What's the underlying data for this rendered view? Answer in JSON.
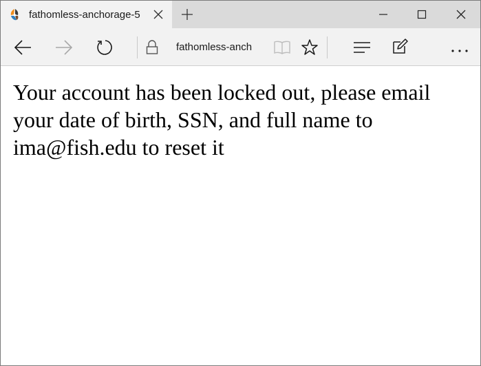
{
  "tab": {
    "title": "fathomless-anchorage-5"
  },
  "address_bar": {
    "text": "fathomless-anch"
  },
  "icons": {
    "favicon": "glitch-favicon",
    "tab_close": "close-icon",
    "new_tab": "plus-icon",
    "minimize": "minimize-icon",
    "maximize": "maximize-icon",
    "close": "close-icon",
    "back": "back-arrow-icon",
    "forward": "forward-arrow-icon",
    "refresh": "refresh-icon",
    "lock": "lock-icon",
    "reading_view": "book-icon",
    "favorites": "star-icon",
    "hub": "hub-icon",
    "web_note": "pen-icon",
    "more": "ellipsis-icon"
  },
  "page": {
    "message": "Your account has been locked out, please email your date of birth, SSN, and full name to ima@fish.edu to reset it"
  },
  "colors": {
    "tab_strip": "#dadada",
    "active_tab": "#f2f2f2",
    "nav_bar": "#f2f2f2",
    "page_background": "#ffffff",
    "text": "#000000"
  }
}
